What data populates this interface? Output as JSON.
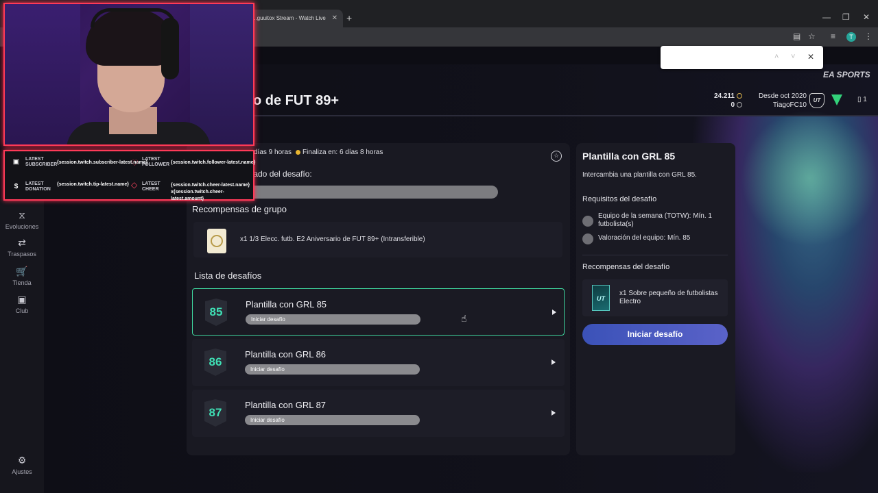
{
  "browser": {
    "tab_title": "...guuitox Stream - Watch Live",
    "tab_close": "✕",
    "new_tab": "+",
    "minimize": "—",
    "restore": "❐",
    "close": "✕",
    "profile_initial": "T"
  },
  "findbar": {
    "up": "˄",
    "down": "˅",
    "close": "✕"
  },
  "header": {
    "brand": "EA SPORTS",
    "page_title": "o de FUT 89+",
    "coins": "24.211",
    "points": "0",
    "since": "Desde oct 2020",
    "username": "TiagoFC10",
    "ut_badge": "UT",
    "count": "1"
  },
  "sidebar": {
    "items": [
      {
        "label": "Evoluciones",
        "icon": "evolutions-icon",
        "glyph": "⧖"
      },
      {
        "label": "Traspasos",
        "icon": "transfers-icon",
        "glyph": "⇄"
      },
      {
        "label": "Tienda",
        "icon": "cart-icon",
        "glyph": "🛒"
      },
      {
        "label": "Club",
        "icon": "club-icon",
        "glyph": "▣"
      },
      {
        "label": "Ajustes",
        "icon": "gear-icon",
        "glyph": "⚙"
      }
    ]
  },
  "main": {
    "timer_left": "días 9 horas",
    "timer_right": "Finaliza en: 6 días 8 horas",
    "progress_label": "Estado del desafío:",
    "group_rewards_title": "Recompensas de grupo",
    "group_reward": "x1 1/3 Elecc. futb. E2 Aniversario de FUT 89+ (Intransferible)",
    "challenges_title": "Lista de desafíos",
    "challenges": [
      {
        "rating": "85",
        "name": "Plantilla con GRL 85",
        "action": "Iniciar desafío"
      },
      {
        "rating": "86",
        "name": "Plantilla con GRL 86",
        "action": "Iniciar desafío"
      },
      {
        "rating": "87",
        "name": "Plantilla con GRL 87",
        "action": "Iniciar desafío"
      }
    ]
  },
  "detail": {
    "title": "Plantilla con GRL 85",
    "description": "Intercambia una plantilla con GRL 85.",
    "requirements_title": "Requisitos del desafío",
    "requirements": [
      "Equipo de la semana (TOTW): Mín. 1 futbolista(s)",
      "Valoración del equipo: Mín. 85"
    ],
    "rewards_title": "Recompensas del desafío",
    "reward": "x1 Sobre pequeño de futbolistas Electro",
    "pack_label": "UT",
    "cta": "Iniciar desafío"
  },
  "overlay": {
    "sub_label": "LATEST SUBSCRIBER",
    "sub_value": "{session.twitch.subscriber-latest.name}",
    "follow_label": "LATEST FOLLOWER",
    "follow_value": "{session.twitch.follower-latest.name}",
    "donation_label": "LATEST DONATION",
    "donation_value": "{session.twitch.tip-latest.name}",
    "cheer_label": "LATEST CHEER",
    "cheer_value": "{session.twitch.cheer-latest.name} x{session.twitch.cheer-latest.amount}"
  },
  "colors": {
    "accent": "#3fd9a0",
    "overlay_border": "#ff3a58",
    "cta": "#4a5ac0"
  }
}
